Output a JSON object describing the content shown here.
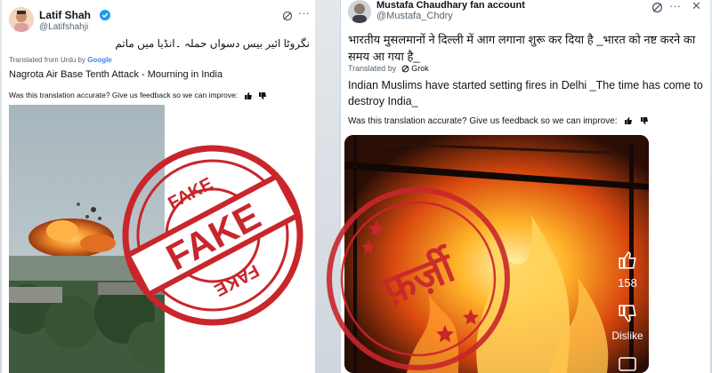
{
  "left_post": {
    "display_name": "Latif Shah",
    "handle": "@Latifshahji",
    "original_text": "نگروٹا ائیر بیس دسواں حملہ ۔انڈیا میں ماتم",
    "translated_from_prefix": "Translated from Urdu by",
    "translator": "Google",
    "translation": "Nagrota Air Base Tenth Attack - Mourning in India",
    "feedback_prompt": "Was this translation accurate? Give us feedback so we can improve:",
    "stamp_text": "FAKE"
  },
  "right_post": {
    "display_name": "Mustafa Chaudhary fan account",
    "handle": "@Mustafa_Chdry",
    "original_text": "भारतीय मुसलमानों ने दिल्ली में आग लगाना शुरू कर दिया है _भारत को नष्ट करने का समय आ गया है_",
    "translated_from_prefix": "Translated by",
    "translator": "Grok",
    "translation": "Indian Muslims have started setting fires in Delhi _The time has come to destroy India_",
    "feedback_prompt": "Was this translation accurate? Give us feedback so we can improve:",
    "like_count": "158",
    "dislike_label": "Dislike",
    "stamp_text": "फ़र्ज़ी"
  },
  "icons": {
    "verified": "verified-badge-icon",
    "grok": "grok-icon",
    "more": "more-icon",
    "close": "close-icon",
    "thumbs_up": "thumbs-up-icon",
    "thumbs_down": "thumbs-down-icon"
  },
  "colors": {
    "stamp_red": "#c8262b",
    "verified_blue": "#1d9bf0",
    "google_blue": "#4285f4"
  }
}
